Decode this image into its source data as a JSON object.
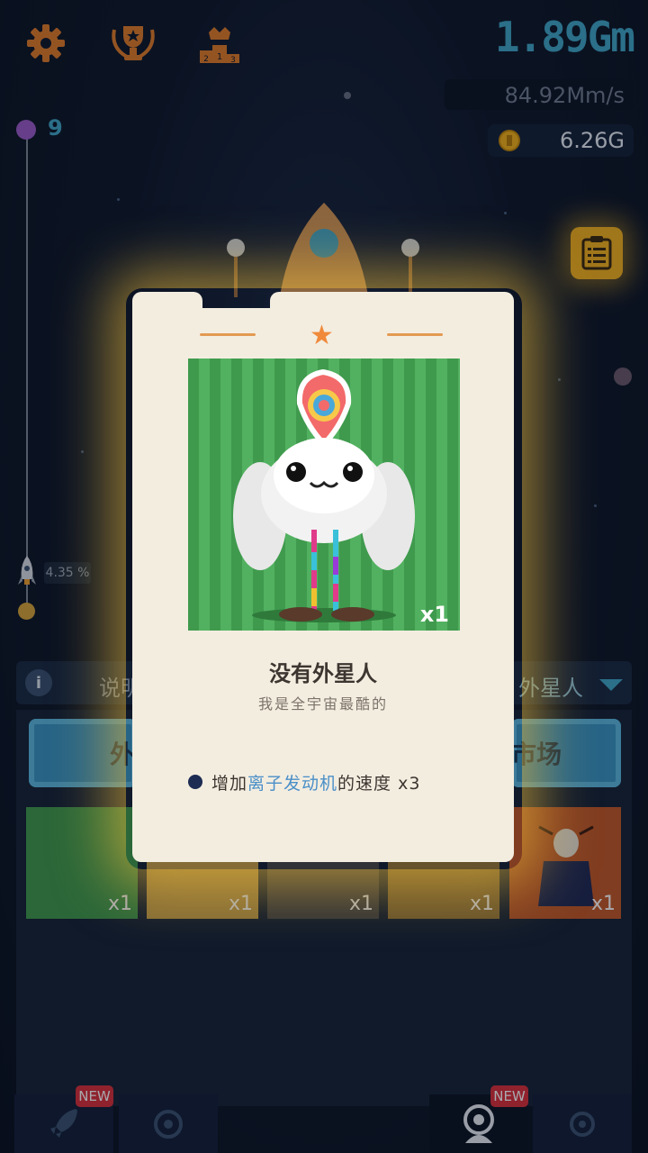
{
  "hud": {
    "distance": "1.89Gm",
    "speed": "84.92Mm/s",
    "coins": "6.26G",
    "level": "9",
    "progress_percent": "4.35 %",
    "progress_fraction": 0.0435
  },
  "icons": {
    "settings": "gear-icon",
    "achievements": "trophy-icon",
    "leaderboard": "podium-icon",
    "tasks": "clipboard-icon"
  },
  "background_ui": {
    "info_label": "说明",
    "category_label": "外星人",
    "tab_left_label": "外",
    "tab_right_label": "市场"
  },
  "cards": [
    {
      "count": "x1",
      "color": "#3f9a4d"
    },
    {
      "count": "x1",
      "color": "#c9a24a"
    },
    {
      "count": "x1",
      "color": "#4a4a4a"
    },
    {
      "count": "x1",
      "color": "#9a7a3a"
    },
    {
      "count": "x1",
      "color": "#c45a28"
    }
  ],
  "nav": {
    "new_badge_1": "NEW",
    "new_badge_2": "NEW"
  },
  "modal": {
    "count": "x1",
    "name": "没有外星人",
    "subtitle": "我是全宇宙最酷的",
    "effect_prefix": "增加",
    "effect_highlight": "离子发动机",
    "effect_suffix": "的速度 x3"
  }
}
